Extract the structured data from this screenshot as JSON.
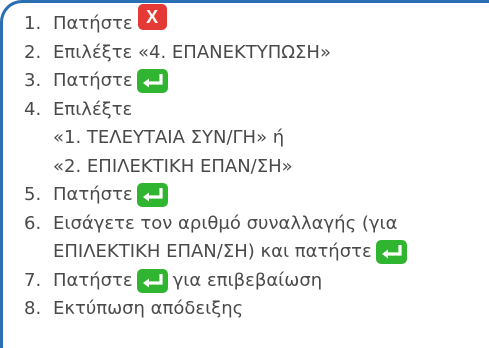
{
  "steps": [
    {
      "num": "1.",
      "pre": "Πατήστε",
      "key": "x-key",
      "key_label": "X",
      "post": ""
    },
    {
      "num": "2.",
      "pre": "Επιλέξτε «4. ΕΠΑΝΕΚΤΥΠΩΣΗ»",
      "key": "",
      "post": ""
    },
    {
      "num": "3.",
      "pre": "Πατήστε",
      "key": "enter-key",
      "post": ""
    },
    {
      "num": "4.",
      "pre": "Επιλέξτε",
      "key": "",
      "post": ""
    },
    {
      "num": "",
      "pre": "«1. ΤΕΛΕΥΤΑΙΑ ΣΥΝ/ΓΗ» ή",
      "key": "",
      "post": ""
    },
    {
      "num": "",
      "pre": "«2. ΕΠΙΛΕΚΤΙΚΗ ΕΠΑΝ/ΣΗ»",
      "key": "",
      "post": ""
    },
    {
      "num": "5.",
      "pre": "Πατήστε",
      "key": "enter-key",
      "post": ""
    },
    {
      "num": "6.",
      "pre": "Εισάγετε τον αριθμό συναλλαγής (για",
      "key": "",
      "post": ""
    },
    {
      "num": "",
      "pre": "ΕΠΙΛΕΚΤΙΚΗ ΕΠΑΝ/ΣΗ) και πατήστε",
      "key": "enter-key",
      "post": ""
    },
    {
      "num": "7.",
      "pre": "Πατήστε",
      "key": "enter-key",
      "post": "για επιβεβαίωση"
    },
    {
      "num": "8.",
      "pre": "Εκτύπωση απόδειξης",
      "key": "",
      "post": ""
    }
  ],
  "colors": {
    "frame": "#2a6fb3",
    "text": "#4a4a4a",
    "x_key": "#e53935",
    "enter_key": "#2fb52f"
  }
}
